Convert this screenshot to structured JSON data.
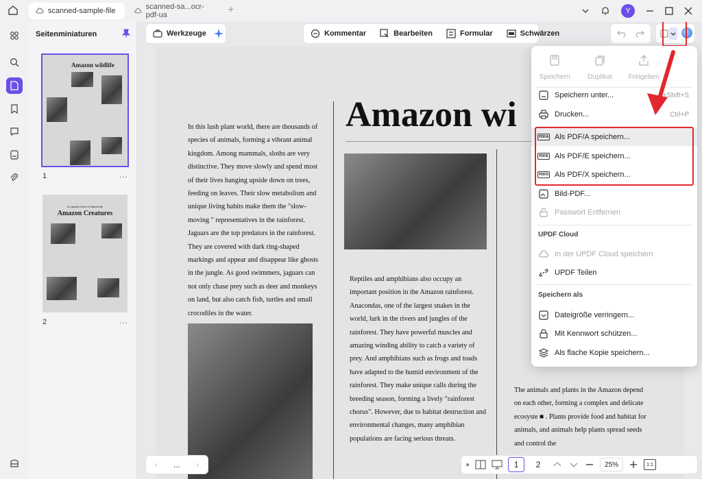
{
  "tabs": [
    {
      "label": "scanned-sample-file"
    },
    {
      "label": "scanned-sa...ocr-pdf-ua"
    }
  ],
  "user": {
    "initial": "Y"
  },
  "thumbnails": {
    "title": "Seitenminiaturen",
    "pages": [
      {
        "number": "1",
        "heading": "Amazon wildlife"
      },
      {
        "number": "2",
        "kicker": "A massive trove of natural life",
        "heading": "Amazon Creatures"
      }
    ],
    "more": "..."
  },
  "toolbar": {
    "tools_label": "Werkzeuge",
    "comment_label": "Kommentar",
    "edit_label": "Bearbeiten",
    "form_label": "Formular",
    "redact_label": "Schwärzen"
  },
  "document": {
    "heading": "Amazon wi",
    "col1": "In this lush plant world, there are thousands of species of animals, forming a vibrant animal kingdom. Among mammals, sloths are very distinctive. They move slowly and spend most of their lives hanging upside down on trees, feeding on leaves. Their slow metabolism and unique living habits make them the \"slow-moving \" representatives in the rainforest. Jaguars are the top predators in the rainforest. They are covered with dark ring-shaped markings and appear and disappear like ghosts in the jungle. As good swimmers, jaguars can not only chase prey such as deer and monkeys on land, but also catch fish, turtles and small crocodiles in the water.",
    "col2": "Reptiles and amphibians also occupy an important position in the Amazon rainforest. Anacondas, one of the largest snakes in the world, lurk in the rivers and jungles of the rainforest. They have powerful muscles and amazing winding ability to catch a variety of prey. And amphibians such as frogs and toads have adapted to the humid environment of the rainforest. They make unique calls during the breeding season, forming a lively \"rainforest chorus\". However, due to habitat destruction and environmental changes, many amphibian populations are facing serious threats.",
    "col3": "The animals and plants in the Amazon depend on each other, forming a complex and delicate ecosyste ■ . Plants provide food and habitat for animals, and animals help plants spread seeds and control the"
  },
  "bottom_nav": {
    "more": "...",
    "page1": "1",
    "page2": "2",
    "zoom": "25%"
  },
  "menu": {
    "top_actions": [
      {
        "label": "Speichern",
        "icon": "save-icon"
      },
      {
        "label": "Duplikat",
        "icon": "duplicate-icon"
      },
      {
        "label": "Freigeben",
        "icon": "share-icon"
      }
    ],
    "save_as_label": "Speichern unter...",
    "save_as_shortcut": "+Shift+S",
    "print_label": "Drucken...",
    "print_shortcut": "Ctrl+P",
    "pdfa_label": "Als PDF/A speichern...",
    "pdfe_label": "Als PDF/E speichern...",
    "pdfx_label": "Als PDF/X speichern...",
    "pdfa_icon": "PDF/A",
    "pdfe_icon": "PDF/E",
    "pdfx_icon": "PDF/X",
    "image_pdf_label": "Bild-PDF...",
    "remove_password_label": "Passwort Entfernen",
    "cloud_section": "UPDF Cloud",
    "cloud_save_label": "In der UPDF Cloud speichern",
    "share_label": "UPDF Teilen",
    "save_as_section": "Speichern als",
    "reduce_size_label": "Dateigröße verringern...",
    "password_protect_label": "Mit Kennwort schützen...",
    "flat_copy_label": "Als flache Kopie speichern..."
  },
  "colors": {
    "accent": "#6b4ee6",
    "annotation": "#e0282e"
  }
}
